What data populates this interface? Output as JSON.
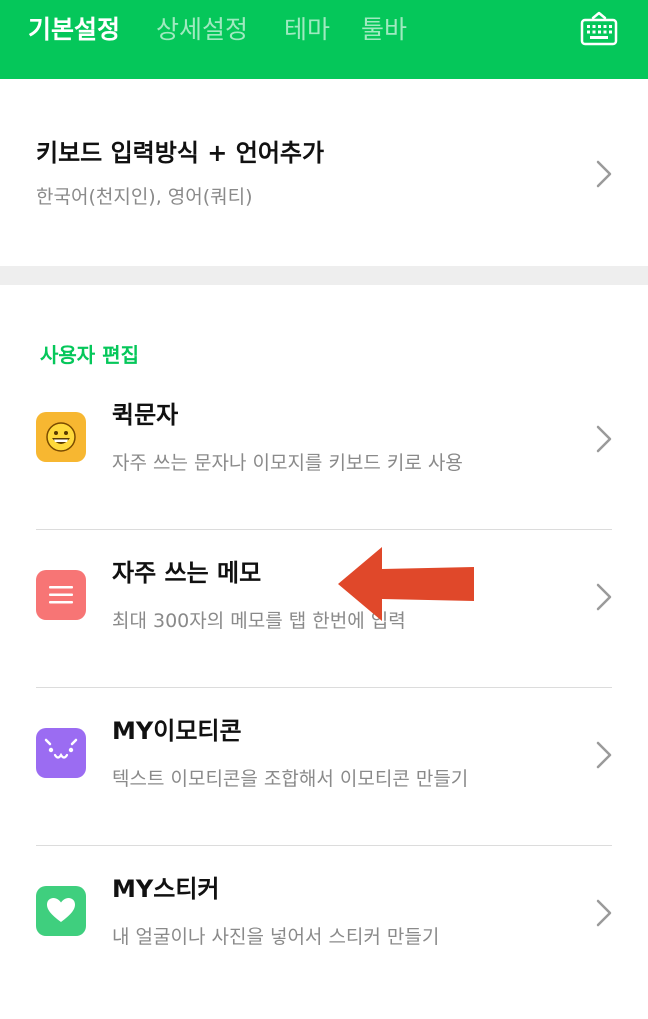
{
  "tabs": [
    {
      "label": "기본설정",
      "active": true
    },
    {
      "label": "상세설정",
      "active": false
    },
    {
      "label": "테마",
      "active": false
    },
    {
      "label": "툴바",
      "active": false
    }
  ],
  "header": {
    "keyboard_icon": "keyboard-icon",
    "accent_color": "#05c75a"
  },
  "input_method": {
    "title": "키보드 입력방식 + 언어추가",
    "subtitle": "한국어(천지인), 영어(쿼티)"
  },
  "user_edit": {
    "section_label": "사용자 편집",
    "items": [
      {
        "title": "퀵문자",
        "subtitle": "자주 쓰는 문자나 이모지를 키보드 키로 사용",
        "icon": "smiley-icon",
        "icon_color": "#f7b731"
      },
      {
        "title": "자주 쓰는 메모",
        "subtitle": "최대 300자의 메모를 탭 한번에 입력",
        "icon": "memo-lines-icon",
        "icon_color": "#f77575"
      },
      {
        "title": "MY이모티콘",
        "subtitle": "텍스트 이모티콘을 조합해서 이모티콘 만들기",
        "icon": "emoticon-face-icon",
        "icon_color": "#9b6cf2"
      },
      {
        "title": "MY스티커",
        "subtitle": "내 얼굴이나 사진을 넣어서 스티커 만들기",
        "icon": "heart-icon",
        "icon_color": "#3fcf7e"
      }
    ]
  },
  "annotation": {
    "arrow_color": "#e0482a",
    "arrow_icon": "red-arrow-left-icon"
  }
}
